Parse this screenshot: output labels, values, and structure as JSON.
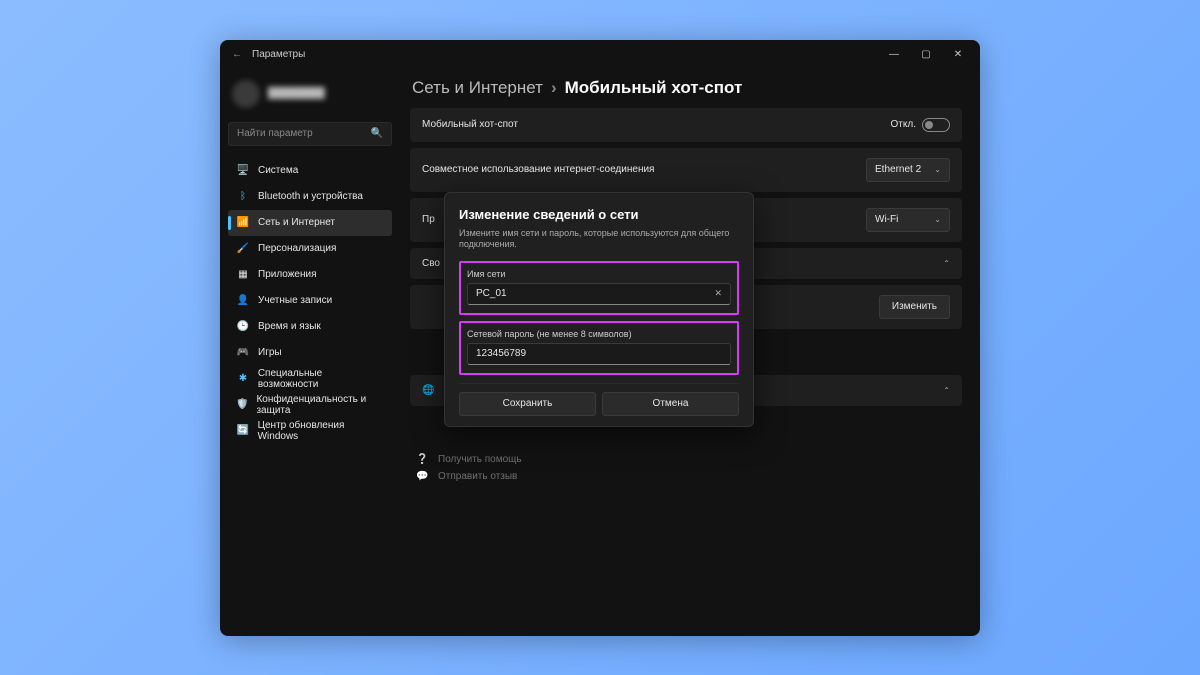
{
  "window": {
    "title": "Параметры"
  },
  "search": {
    "placeholder": "Найти параметр"
  },
  "nav": {
    "system": {
      "label": "Система",
      "icon": "🖥️"
    },
    "bluetooth": {
      "label": "Bluetooth и устройства",
      "icon": "ᛒ"
    },
    "network": {
      "label": "Сеть и Интернет",
      "icon": "📶"
    },
    "personalization": {
      "label": "Персонализация",
      "icon": "🖌️"
    },
    "apps": {
      "label": "Приложения",
      "icon": "▦"
    },
    "accounts": {
      "label": "Учетные записи",
      "icon": "👤"
    },
    "time": {
      "label": "Время и язык",
      "icon": "🕒"
    },
    "games": {
      "label": "Игры",
      "icon": "🎮"
    },
    "accessibility": {
      "label": "Специальные возможности",
      "icon": "✱"
    },
    "privacy": {
      "label": "Конфиденциальность и защита",
      "icon": "🛡️"
    },
    "update": {
      "label": "Центр обновления Windows",
      "icon": "🔄"
    }
  },
  "breadcrumb": {
    "root": "Сеть и Интернет",
    "sep": "›",
    "page": "Мобильный хот-спот"
  },
  "cards": {
    "hotspot": {
      "label": "Мобильный хот-спот",
      "state": "Откл."
    },
    "share": {
      "label": "Совместное использование интернет-соединения",
      "value": "Ethernet 2"
    },
    "pr_stub": {
      "label": "Пр"
    },
    "wifi_value": "Wi-Fi",
    "sv_stub": {
      "label": "Сво"
    },
    "edit_button": "Изменить"
  },
  "dialog": {
    "title": "Изменение сведений о сети",
    "desc": "Измените имя сети и пароль, которые используются для общего подключения.",
    "name_label": "Имя сети",
    "name_value": "PC_01",
    "pwd_label": "Сетевой пароль (не менее 8 символов)",
    "pwd_value": "123456789",
    "save": "Сохранить",
    "cancel": "Отмена"
  },
  "help": {
    "get_help": "Получить помощь",
    "feedback": "Отправить отзыв"
  },
  "icons": {
    "globe": "🌐"
  }
}
